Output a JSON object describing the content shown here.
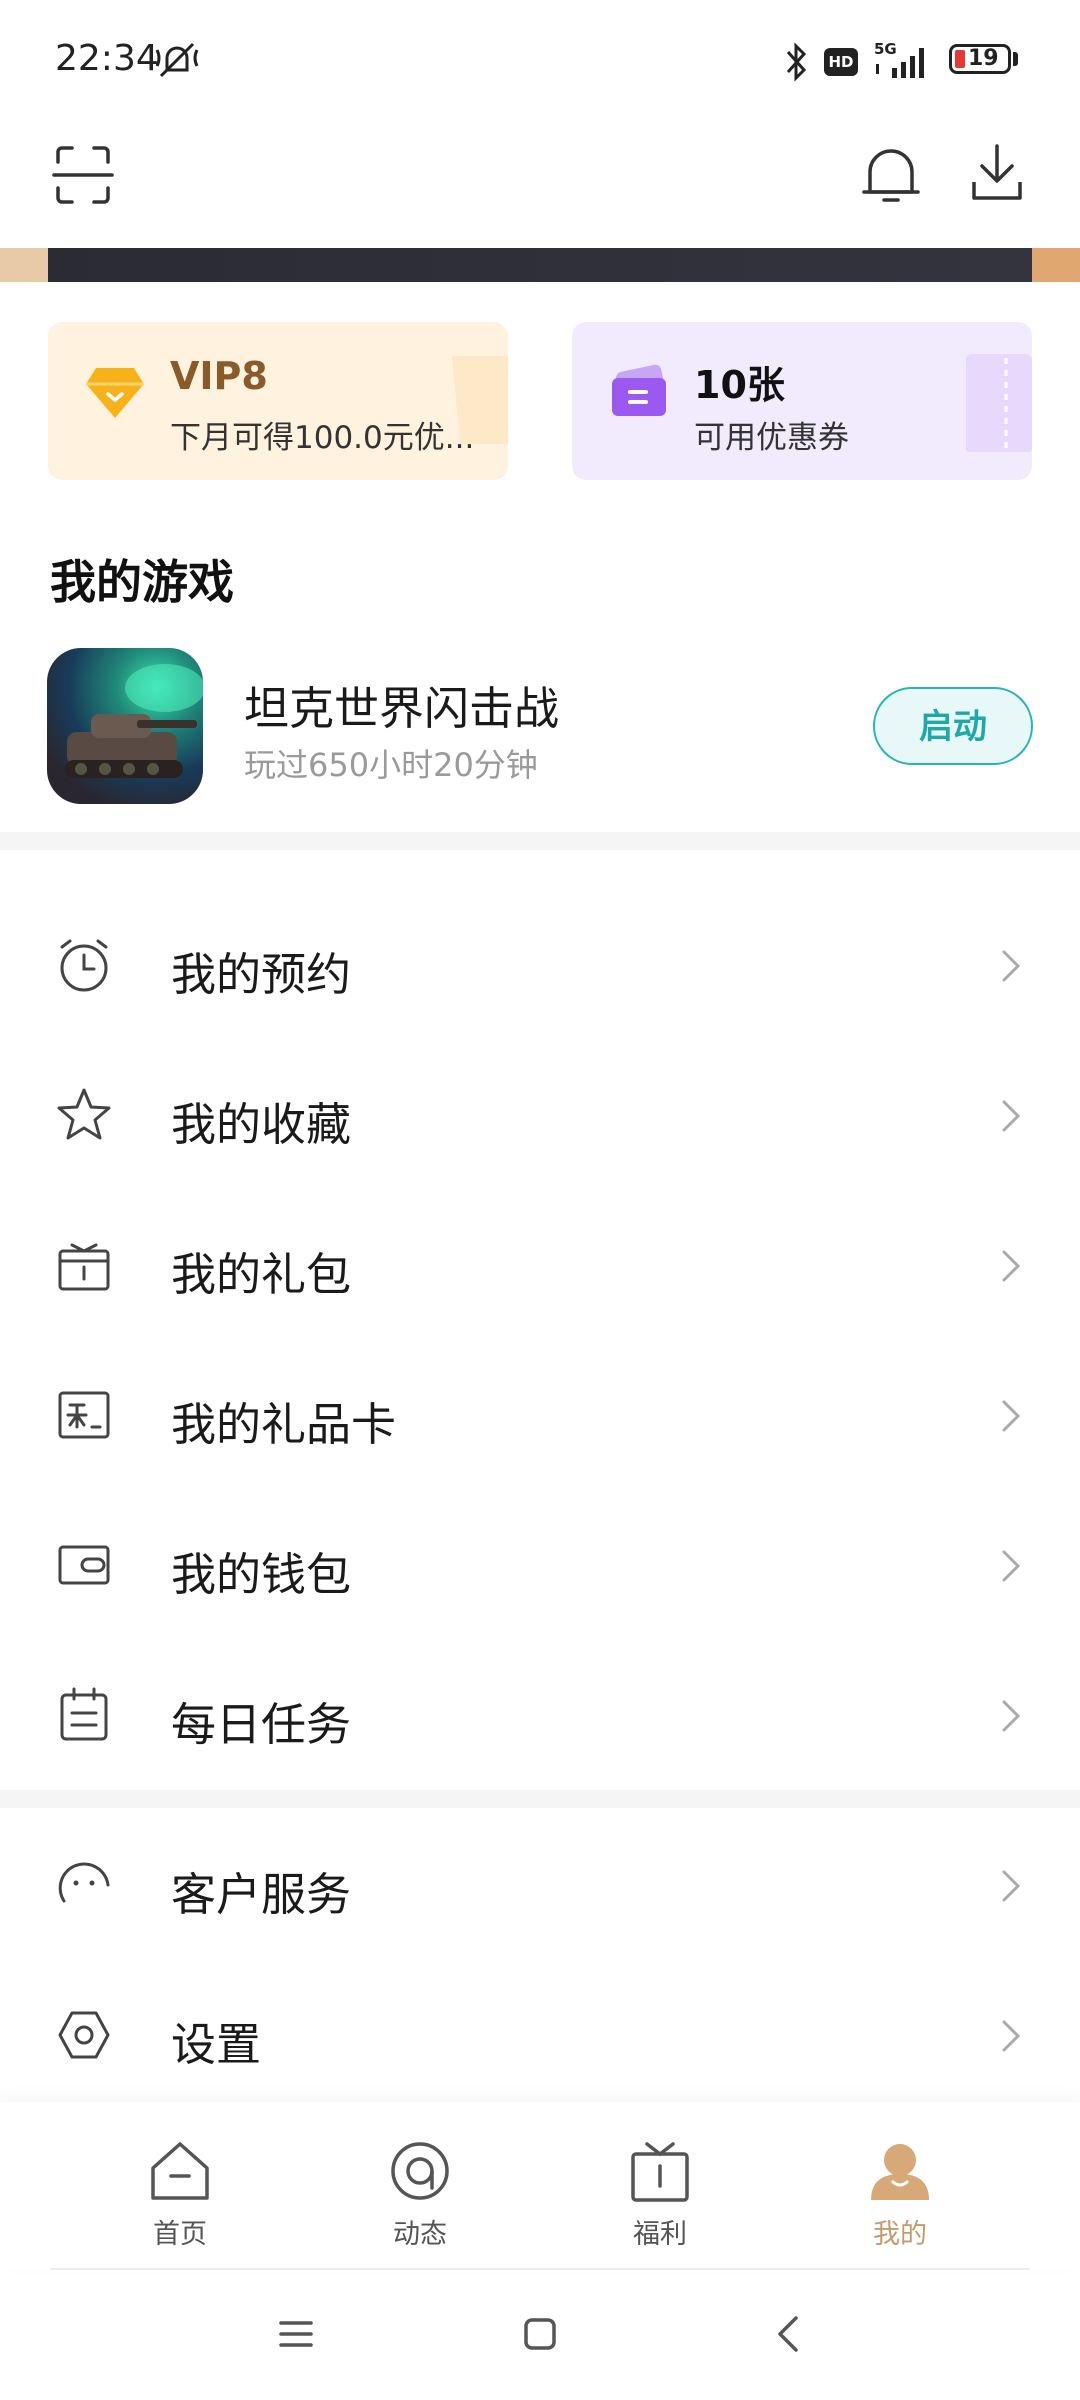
{
  "status_bar": {
    "time": "22:34",
    "battery": "19",
    "network": "5G"
  },
  "header": {
    "scan_icon": "scan-icon",
    "bell_icon": "bell-icon",
    "download_icon": "download-icon"
  },
  "cards": {
    "vip": {
      "title": "VIP8",
      "subtitle": "下月可得100.0元优..."
    },
    "coupon": {
      "title": "10张",
      "subtitle": "可用优惠券"
    }
  },
  "my_games": {
    "title": "我的游戏",
    "game": {
      "name": "坦克世界闪击战",
      "playtime": "玩过650小时20分钟",
      "launch_label": "启动"
    }
  },
  "menu": [
    {
      "label": "我的预约",
      "icon": "alarm-clock-icon"
    },
    {
      "label": "我的收藏",
      "icon": "star-icon"
    },
    {
      "label": "我的礼包",
      "icon": "gift-box-icon"
    },
    {
      "label": "我的礼品卡",
      "icon": "gift-card-icon"
    },
    {
      "label": "我的钱包",
      "icon": "wallet-icon"
    },
    {
      "label": "每日任务",
      "icon": "calendar-task-icon"
    }
  ],
  "menu2": [
    {
      "label": "客户服务",
      "icon": "service-icon"
    },
    {
      "label": "设置",
      "icon": "settings-icon"
    }
  ],
  "bottom_nav": [
    {
      "label": "首页",
      "icon": "home-icon"
    },
    {
      "label": "动态",
      "icon": "feed-icon"
    },
    {
      "label": "福利",
      "icon": "gift-icon"
    },
    {
      "label": "我的",
      "icon": "profile-icon",
      "active": true
    }
  ],
  "colors": {
    "accent": "#27b5b5",
    "active_nav": "#c79a6e",
    "vip_bg": "#fff3e0",
    "coupon_bg": "#f1ebfd"
  }
}
